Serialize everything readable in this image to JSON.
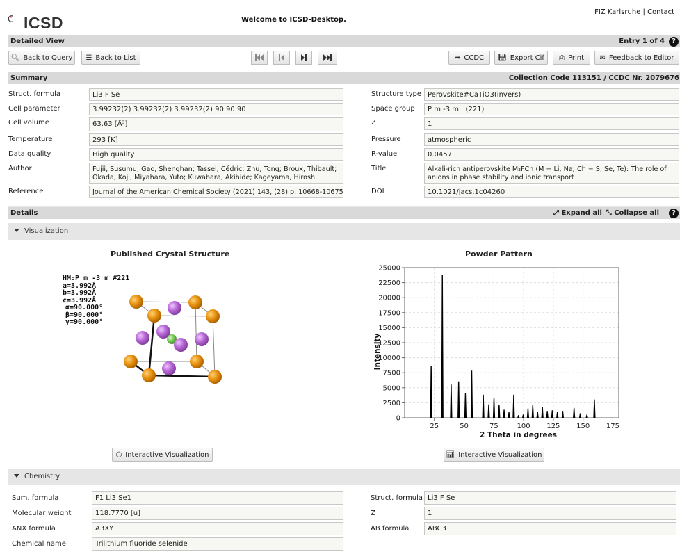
{
  "header": {
    "logo_text": "ICSD",
    "welcome": "Welcome to ICSD-Desktop.",
    "link_fiz": "FIZ Karlsruhe",
    "separator": "|",
    "link_contact": "Contact"
  },
  "detailed_view": {
    "title": "Detailed View",
    "entry": "Entry 1 of 4"
  },
  "toolbar": {
    "back_query": "Back to Query",
    "back_list": "Back to List",
    "ccdc": "CCDC",
    "export_cif": "Export Cif",
    "print": "Print",
    "feedback": "Feedback to Editor"
  },
  "summary": {
    "title": "Summary",
    "code": "Collection Code 113151 / CCDC Nr. 2079676",
    "left": [
      {
        "label": "Struct. formula",
        "value": "Li3 F Se"
      },
      {
        "label": "Cell parameter",
        "value": "3.99232(2) 3.99232(2) 3.99232(2) 90 90 90"
      },
      {
        "label": "Cell volume",
        "value": "63.63 [Å³]"
      },
      {
        "label": "Temperature",
        "value": "293 [K]"
      },
      {
        "label": "Data quality",
        "value": "High quality"
      },
      {
        "label": "Author",
        "value": "Fujii, Susumu; Gao, Shenghan; Tassel, Cédric; Zhu, Tong; Broux, Thibault; Okada, Koji; Miyahara, Yuto; Kuwabara, Akihide; Kageyama, Hiroshi"
      },
      {
        "label": "Reference",
        "value": "Journal of the American Chemical Society (2021) 143, (28) p. 10668-10675"
      }
    ],
    "right": [
      {
        "label": "Structure type",
        "value": "Perovskite#CaTiO3(invers)"
      },
      {
        "label": "Space group",
        "value": "P m -3 m   (221)"
      },
      {
        "label": "Z",
        "value": "1"
      },
      {
        "label": "Pressure",
        "value": "atmospheric"
      },
      {
        "label": "R-value",
        "value": "0.0457"
      },
      {
        "label": "Title",
        "value": "Alkali-rich antiperovskite M₃FCh (M = Li, Na; Ch = S, Se, Te): The role of anions in phase stability and ionic transport"
      },
      {
        "label": "DOI",
        "value": "10.1021/jacs.1c04260"
      }
    ]
  },
  "details": {
    "title": "Details",
    "expand": "Expand all",
    "collapse": "Collapse all"
  },
  "visualization": {
    "title": "Visualization",
    "crystal_title": "Published Crystal Structure",
    "crystal_info": [
      "HM:P m -3 m #221",
      "a=3.992Å",
      "b=3.992Å",
      "c=3.992Å",
      "α=90.000°",
      "β=90.000°",
      "γ=90.000°"
    ],
    "powder_title": "Powder Pattern",
    "interactive_btn": "Interactive Visualization",
    "interactive_btn2": "Interactive Visualization"
  },
  "chart_data": {
    "type": "bar",
    "title": "Powder Pattern",
    "xlabel": "2 Theta in degrees",
    "ylabel": "Intensity",
    "xlim": [
      0,
      180
    ],
    "ylim": [
      0,
      25000
    ],
    "xticks": [
      25,
      50,
      75,
      100,
      125,
      150,
      175
    ],
    "yticks": [
      0,
      2500,
      5000,
      7500,
      10000,
      12500,
      15000,
      17500,
      20000,
      22500,
      25000
    ],
    "grid": true,
    "x": [
      22.3,
      31.7,
      39.1,
      45.4,
      51.1,
      56.4,
      66.1,
      70.7,
      75.1,
      79.4,
      83.6,
      87.7,
      91.7,
      95.7,
      99.7,
      103.7,
      107.7,
      111.7,
      115.8,
      119.9,
      124.1,
      128.4,
      132.9,
      142.4,
      147.6,
      153.2,
      159.5
    ],
    "y": [
      8600,
      23700,
      5500,
      6000,
      4000,
      7800,
      3800,
      2200,
      3300,
      2100,
      1300,
      900,
      3800,
      400,
      500,
      1500,
      2100,
      1000,
      1800,
      1100,
      1200,
      1000,
      1100,
      1600,
      700,
      500,
      3000
    ]
  },
  "chemistry": {
    "title": "Chemistry",
    "left": [
      {
        "label": "Sum. formula",
        "value": "F1 Li3 Se1"
      },
      {
        "label": "Molecular weight",
        "value": "118.7770 [u]"
      },
      {
        "label": "ANX formula",
        "value": "A3XY"
      },
      {
        "label": "Chemical name",
        "value": "Trilithium fluoride selenide"
      }
    ],
    "right": [
      {
        "label": "Struct. formula",
        "value": "Li3 F Se"
      },
      {
        "label": "Z",
        "value": "1"
      },
      {
        "label": "AB formula",
        "value": "ABC3"
      }
    ]
  },
  "colors": {
    "li_atom": "#e8920e",
    "se_atom": "#b767d6",
    "f_atom": "#7ac85a"
  }
}
